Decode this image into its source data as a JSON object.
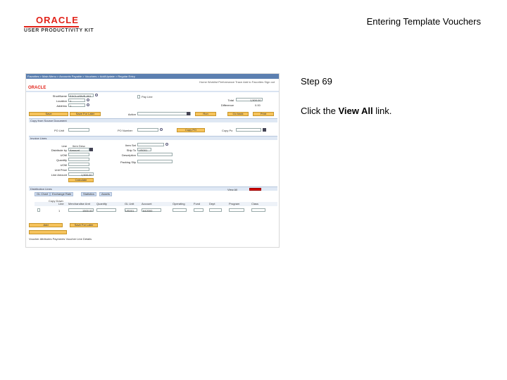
{
  "header": {
    "brand_logo": "ORACLE",
    "brand_sub": "USER PRODUCTIVITY KIT",
    "title": "Entering Template Vouchers"
  },
  "step": {
    "label": "Step 69",
    "instruction_prefix": "Click the ",
    "instruction_target": "View All",
    "instruction_suffix": " link."
  },
  "screenshot": {
    "breadcrumb": "Favorites > Main Menu > Accounts Payable > Vouchers > Add/Update > Regular Entry",
    "top_links": "Home  Worklist  Performance Trace  Add to Favorites  Sign out",
    "logo": "ORACLE",
    "fields": {
      "short_name_label": "ShortName",
      "short_name_value": "EXCLUSIVE-001",
      "location_label": "Location",
      "location_value": "1",
      "address_label": "Address",
      "address_value": "1",
      "total_label": "Total",
      "total_value": "1,500.00",
      "difference_label": "Difference",
      "difference_value": "0.00",
      "invoice_label": "Pay Line",
      "action_label": "Action"
    },
    "buttons": {
      "save": "Save",
      "save_for_later": "Save For Later",
      "run": "Run",
      "go_back": "Go back",
      "print": "Print",
      "copy_po": "Copy PO",
      "calculate": "Calculate",
      "add": "Add",
      "save_for_later_2": "Save For Later"
    },
    "section_copy": "Copy from Source Document",
    "po_unit_label": "PO Unit",
    "po_number_label": "PO Number",
    "copy_from_label": "Copy Po",
    "invoice_lines": "Invoice Lines",
    "line_fields": {
      "line": "Line",
      "item_desc": "Item Desc",
      "distribute_by": "Distribute by",
      "distribute_value": "Amount",
      "uom": "UOM",
      "quantity": "Quantity",
      "uom2": "UOM",
      "unit_price": "Unit Price",
      "line_amount": "Line Amount",
      "line_amount_value": "1,500.00",
      "item_id": "Item Set",
      "ship_to": "Ship To",
      "ship_to_value": "US001",
      "description": "Description",
      "packing_slip": "Packing Slip"
    },
    "distribution": {
      "title": "Distribution Lines",
      "tabs": [
        "GL Chart",
        "Exchange Rate",
        "Statistics",
        "Assets"
      ],
      "view_all": "View All",
      "columns": [
        "Copy Down",
        "Line",
        "Merchandise Amt",
        "Quantity",
        "GL Unit",
        "Account",
        "Operating",
        "Fund",
        "Dept",
        "Program",
        "Class"
      ],
      "row": [
        "1",
        "1500.00",
        "US001",
        "642000"
      ]
    },
    "footer": "Voucher Attributes  Payments  Voucher Line Details"
  }
}
